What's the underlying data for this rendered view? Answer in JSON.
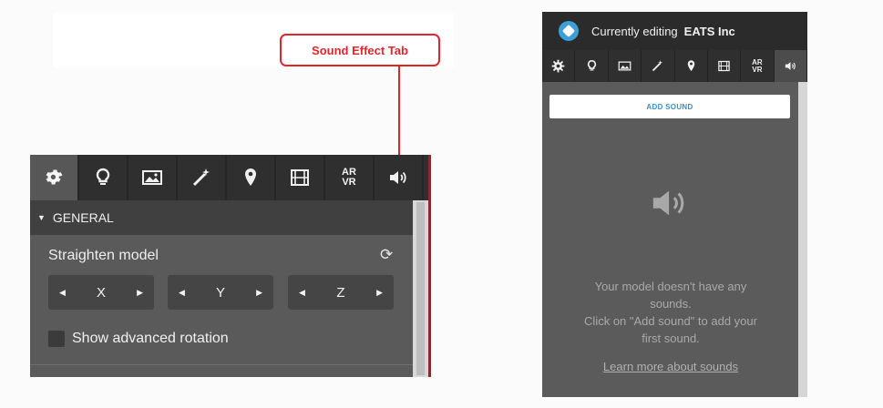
{
  "callout": {
    "label": "Sound Effect Tab",
    "color": "#e0262c"
  },
  "left_panel": {
    "tabs": [
      {
        "name": "settings",
        "icon": "gear-icon"
      },
      {
        "name": "lighting",
        "icon": "lightbulb-icon"
      },
      {
        "name": "background",
        "icon": "image-icon"
      },
      {
        "name": "post-processing",
        "icon": "magic-wand-icon"
      },
      {
        "name": "annotations",
        "icon": "map-pin-icon"
      },
      {
        "name": "animation",
        "icon": "film-icon"
      },
      {
        "name": "ar-vr",
        "label_top": "AR",
        "label_bottom": "VR"
      },
      {
        "name": "sound",
        "icon": "speaker-icon"
      }
    ],
    "section_title": "GENERAL",
    "straighten_label": "Straighten model",
    "axes": [
      "X",
      "Y",
      "Z"
    ],
    "advanced_rotation_label": "Show advanced rotation"
  },
  "right_panel": {
    "header_prefix": "Currently editing",
    "company": "EATS Inc",
    "tabs": [
      {
        "name": "settings",
        "icon": "gear-icon"
      },
      {
        "name": "lighting",
        "icon": "lightbulb-icon"
      },
      {
        "name": "background",
        "icon": "image-icon"
      },
      {
        "name": "post-processing",
        "icon": "magic-wand-icon"
      },
      {
        "name": "annotations",
        "icon": "map-pin-icon"
      },
      {
        "name": "animation",
        "icon": "film-icon"
      },
      {
        "name": "ar-vr",
        "label_top": "AR",
        "label_bottom": "VR"
      },
      {
        "name": "sound",
        "icon": "speaker-icon"
      }
    ],
    "add_sound_label": "ADD SOUND",
    "empty_line1": "Your model doesn't have any",
    "empty_line2": "sounds.",
    "empty_line3": "Click on \"Add sound\" to add your",
    "empty_line4": "first sound.",
    "learn_more": "Learn more about sounds"
  }
}
